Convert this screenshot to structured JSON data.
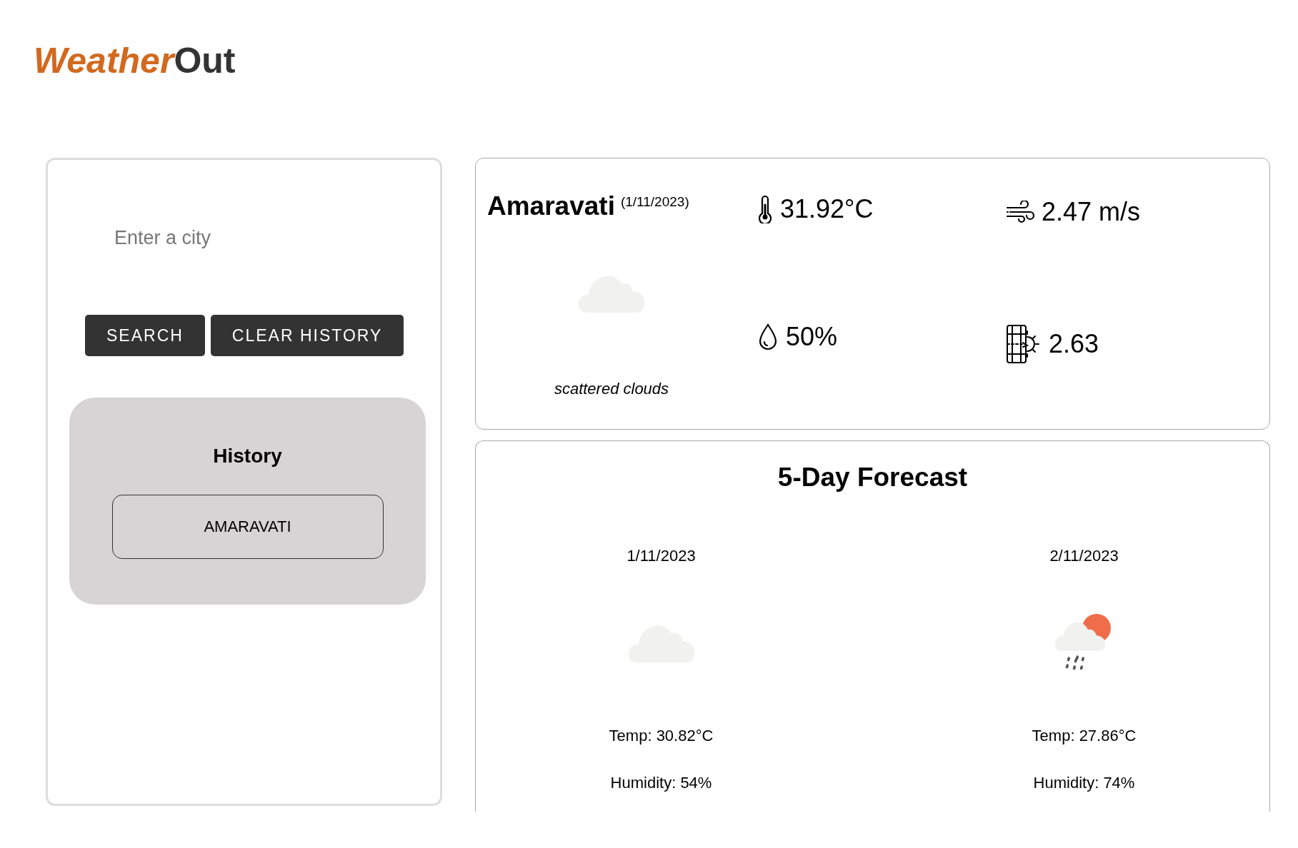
{
  "logo": {
    "part_1": "Weather",
    "part_2": "Out"
  },
  "search": {
    "placeholder": "Enter a city"
  },
  "buttons": [
    {
      "label": "SEARCH"
    },
    {
      "label": "CLEAR HISTORY"
    }
  ],
  "history": {
    "title": "History",
    "items": [
      "AMARAVATI"
    ]
  },
  "current": {
    "city": "Amaravati",
    "date": "(1/11/2023)",
    "kind": "clouds",
    "description": "scattered clouds",
    "stats": [
      {
        "kind": "temperature",
        "value": "31.92°C"
      },
      {
        "kind": "wind",
        "value": "2.47 m/s"
      },
      {
        "kind": "humidity",
        "value": "50%"
      },
      {
        "kind": "uv",
        "value": "2.63"
      }
    ]
  },
  "forecast": {
    "title": "5-Day Forecast",
    "days": [
      {
        "date": "1/11/2023",
        "kind": "clouds",
        "temp": "Temp: 30.82°C",
        "humidity": "Humidity: 54%"
      },
      {
        "date": "2/11/2023",
        "kind": "rain_sun",
        "temp": "Temp: 27.86°C",
        "humidity": "Humidity: 74%"
      }
    ]
  }
}
